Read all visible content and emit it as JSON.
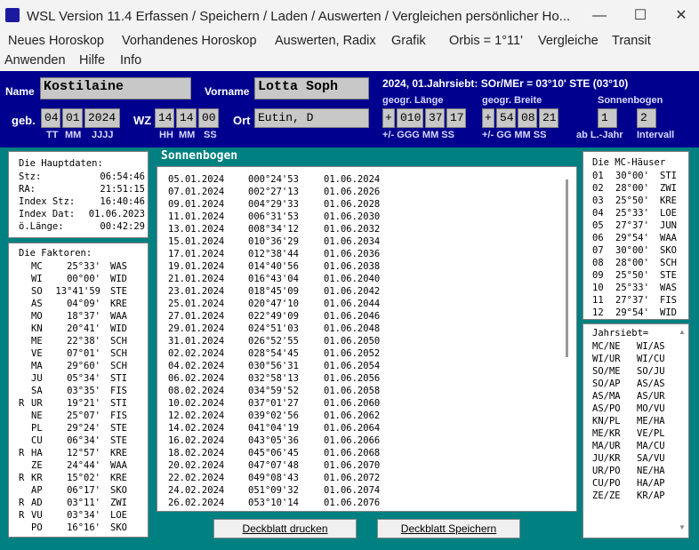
{
  "window": {
    "title": "WSL Version 11.4    Erfassen / Speichern / Laden / Auswerten / Vergleichen persönlicher Ho...",
    "minimize": "—",
    "maximize": "☐",
    "close": "✕"
  },
  "menu": [
    "Neues Horoskop",
    "Vorhandenes Horoskop",
    "Auswerten, Radix",
    "Grafik",
    "Orbis = 1°11'",
    "Vergleiche",
    "Transit",
    "Anwenden",
    "Hilfe",
    "Info"
  ],
  "header": {
    "name_label": "Name",
    "name_value": "Kostilaine",
    "vorname_label": "Vorname",
    "vorname_value": "Lotta Soph",
    "jahrsiebt_text": "2024, 01.Jahrsiebt: SOr/MEr = 03°10' STE (03°10)",
    "geb_label": "geb.",
    "geb_tt": "04",
    "geb_mm": "01",
    "geb_jjjj": "2024",
    "geb_sub_tt": "TT",
    "geb_sub_mm": "MM",
    "geb_sub_jjjj": "JJJJ",
    "wz_label": "WZ",
    "wz_hh": "14",
    "wz_mm": "14",
    "wz_ss": "00",
    "wz_sub_hh": "HH",
    "wz_sub_mm": "MM",
    "wz_sub_ss": "SS",
    "ort_label": "Ort",
    "ort_value": "Eutin, D",
    "laenge_label": "geogr. Länge",
    "laenge_sign": "+",
    "laenge_ggg": "010",
    "laenge_mm": "37",
    "laenge_ss": "17",
    "laenge_sub": "+/-  GGG  MM   SS",
    "breite_label": "geogr. Breite",
    "breite_sign": "+",
    "breite_gg": "54",
    "breite_mm": "08",
    "breite_ss": "21",
    "breite_sub": "+/-  GG  MM   SS",
    "sonnenbogen_label": "Sonnenbogen",
    "ab_ljahr_value": "1",
    "intervall_value": "2",
    "ab_ljahr_label": "ab L.-Jahr",
    "intervall_label": "Intervall"
  },
  "hauptdaten": {
    "title": "Die Hauptdaten:",
    "rows": [
      [
        "Stz:",
        "06:54:46"
      ],
      [
        "RA:",
        "21:51:15"
      ],
      [
        "Index Stz:",
        "16:40:46"
      ],
      [
        "Index Dat:",
        "01.06.2023"
      ],
      [
        "ö.Länge:",
        "00:42:29"
      ]
    ]
  },
  "faktoren": {
    "title": "Die Faktoren:",
    "rows": [
      [
        "",
        "MC",
        "25°33'",
        "WAS"
      ],
      [
        "",
        "WI",
        "00°00'",
        "WID"
      ],
      [
        "",
        "SO",
        "13°41'59",
        "STE"
      ],
      [
        "",
        "AS",
        "04°09'",
        "KRE"
      ],
      [
        "",
        "MO",
        "18°37'",
        "WAA"
      ],
      [
        "",
        "KN",
        "20°41'",
        "WID"
      ],
      [
        "",
        "ME",
        "22°38'",
        "SCH"
      ],
      [
        "",
        "VE",
        "07°01'",
        "SCH"
      ],
      [
        "",
        "MA",
        "29°60'",
        "SCH"
      ],
      [
        "",
        "JU",
        "05°34'",
        "STI"
      ],
      [
        "",
        "SA",
        "03°35'",
        "FIS"
      ],
      [
        "R",
        "UR",
        "19°21'",
        "STI"
      ],
      [
        "",
        "NE",
        "25°07'",
        "FIS"
      ],
      [
        "",
        "PL",
        "29°24'",
        "STE"
      ],
      [
        "",
        "CU",
        "06°34'",
        "STE"
      ],
      [
        "R",
        "HA",
        "12°57'",
        "KRE"
      ],
      [
        "",
        "ZE",
        "24°44'",
        "WAA"
      ],
      [
        "R",
        "KR",
        "15°02'",
        "KRE"
      ],
      [
        "",
        "AP",
        "06°17'",
        "SKO"
      ],
      [
        "R",
        "AD",
        "03°11'",
        "ZWI"
      ],
      [
        "R",
        "VU",
        "03°34'",
        "LOE"
      ],
      [
        "",
        "PO",
        "16°16'",
        "SKO"
      ]
    ]
  },
  "sonnenbogen": {
    "title": "Sonnenbogen",
    "rows": [
      [
        "05.01.2024",
        "000°24'53",
        "01.06.2024"
      ],
      [
        "07.01.2024",
        "002°27'13",
        "01.06.2026"
      ],
      [
        "09.01.2024",
        "004°29'33",
        "01.06.2028"
      ],
      [
        "11.01.2024",
        "006°31'53",
        "01.06.2030"
      ],
      [
        "13.01.2024",
        "008°34'12",
        "01.06.2032"
      ],
      [
        "15.01.2024",
        "010°36'29",
        "01.06.2034"
      ],
      [
        "17.01.2024",
        "012°38'44",
        "01.06.2036"
      ],
      [
        "19.01.2024",
        "014°40'56",
        "01.06.2038"
      ],
      [
        "21.01.2024",
        "016°43'04",
        "01.06.2040"
      ],
      [
        "23.01.2024",
        "018°45'09",
        "01.06.2042"
      ],
      [
        "25.01.2024",
        "020°47'10",
        "01.06.2044"
      ],
      [
        "27.01.2024",
        "022°49'09",
        "01.06.2046"
      ],
      [
        "29.01.2024",
        "024°51'03",
        "01.06.2048"
      ],
      [
        "31.01.2024",
        "026°52'55",
        "01.06.2050"
      ],
      [
        "02.02.2024",
        "028°54'45",
        "01.06.2052"
      ],
      [
        "04.02.2024",
        "030°56'31",
        "01.06.2054"
      ],
      [
        "06.02.2024",
        "032°58'13",
        "01.06.2056"
      ],
      [
        "08.02.2024",
        "034°59'52",
        "01.06.2058"
      ],
      [
        "10.02.2024",
        "037°01'27",
        "01.06.2060"
      ],
      [
        "12.02.2024",
        "039°02'56",
        "01.06.2062"
      ],
      [
        "14.02.2024",
        "041°04'19",
        "01.06.2064"
      ],
      [
        "16.02.2024",
        "043°05'36",
        "01.06.2066"
      ],
      [
        "18.02.2024",
        "045°06'45",
        "01.06.2068"
      ],
      [
        "20.02.2024",
        "047°07'48",
        "01.06.2070"
      ],
      [
        "22.02.2024",
        "049°08'43",
        "01.06.2072"
      ],
      [
        "24.02.2024",
        "051°09'32",
        "01.06.2074"
      ],
      [
        "26.02.2024",
        "053°10'14",
        "01.06.2076"
      ]
    ]
  },
  "haeuser": {
    "title": "Die MC-Häuser",
    "rows": [
      [
        "01",
        "30°00'",
        "STI"
      ],
      [
        "02",
        "28°00'",
        "ZWI"
      ],
      [
        "03",
        "25°50'",
        "KRE"
      ],
      [
        "04",
        "25°33'",
        "LOE"
      ],
      [
        "05",
        "27°37'",
        "JUN"
      ],
      [
        "06",
        "29°54'",
        "WAA"
      ],
      [
        "07",
        "30°00'",
        "SKO"
      ],
      [
        "08",
        "28°00'",
        "SCH"
      ],
      [
        "09",
        "25°50'",
        "STE"
      ],
      [
        "10",
        "25°33'",
        "WAS"
      ],
      [
        "11",
        "27°37'",
        "FIS"
      ],
      [
        "12",
        "29°54'",
        "WID"
      ]
    ]
  },
  "jahrsiebt": {
    "title": "Jahrsiebt=",
    "rows": [
      [
        "MC/NE",
        "WI/AS"
      ],
      [
        "WI/UR",
        "WI/CU"
      ],
      [
        "SO/ME",
        "SO/JU"
      ],
      [
        "SO/AP",
        "AS/AS"
      ],
      [
        "AS/MA",
        "AS/UR"
      ],
      [
        "AS/PO",
        "MO/VU"
      ],
      [
        "KN/PL",
        "ME/HA"
      ],
      [
        "ME/KR",
        "VE/PL"
      ],
      [
        "MA/UR",
        "MA/CU"
      ],
      [
        "JU/KR",
        "SA/VU"
      ],
      [
        "UR/PO",
        "NE/HA"
      ],
      [
        "CU/PO",
        "HA/AP"
      ],
      [
        "ZE/ZE",
        "KR/AP"
      ]
    ]
  },
  "buttons": {
    "drucken": "Deckblatt drucken",
    "speichern": "Deckblatt Speichern"
  },
  "colors": {
    "header_bg": "#00008e",
    "main_bg": "#008080",
    "field_bg": "#c8c8c8"
  }
}
